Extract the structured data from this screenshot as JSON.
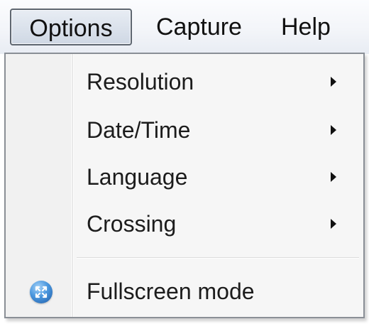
{
  "menubar": {
    "items": [
      {
        "label": "Options",
        "active": true
      },
      {
        "label": "Capture",
        "active": false
      },
      {
        "label": "Help",
        "active": false
      }
    ]
  },
  "dropdown": {
    "items": [
      {
        "label": "Resolution",
        "has_submenu": true
      },
      {
        "label": "Date/Time",
        "has_submenu": true
      },
      {
        "label": "Language",
        "has_submenu": true
      },
      {
        "label": "Crossing",
        "has_submenu": true
      }
    ],
    "fullscreen": {
      "label": "Fullscreen mode",
      "icon": "fullscreen-icon"
    }
  },
  "colors": {
    "menu_background": "#f6f6f6",
    "active_highlight": "#cfd8e4",
    "icon_blue": "#4a97de"
  }
}
